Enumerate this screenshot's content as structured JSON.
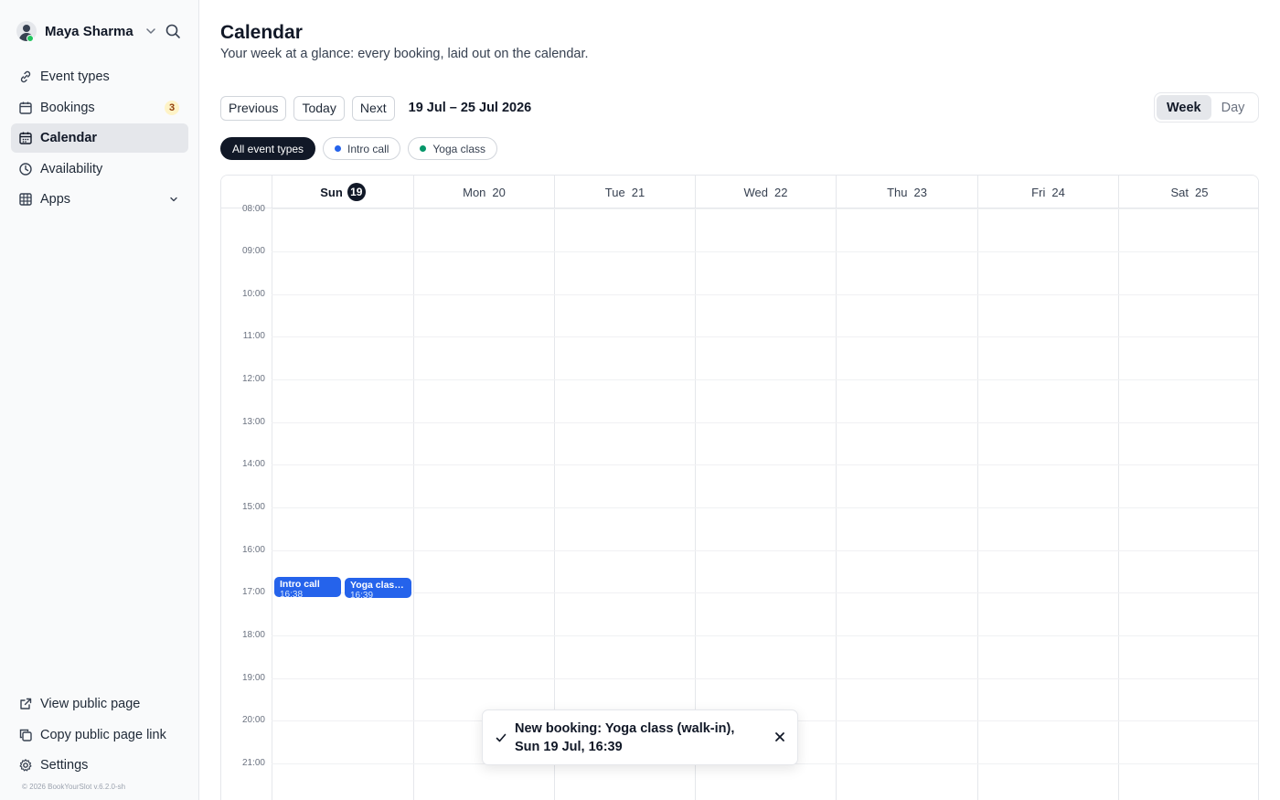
{
  "user": {
    "name": "Maya Sharma",
    "avatar_icon": "user-avatar-icon",
    "status": "online"
  },
  "sidebar": {
    "items": [
      {
        "label": "Event types",
        "icon": "link-icon"
      },
      {
        "label": "Bookings",
        "icon": "calendar-icon",
        "badge": "3"
      },
      {
        "label": "Calendar",
        "icon": "calendar-grid-icon",
        "active": true
      },
      {
        "label": "Availability",
        "icon": "clock-icon"
      },
      {
        "label": "Apps",
        "icon": "grid-icon",
        "expandable": true
      }
    ],
    "bottom_items": [
      {
        "label": "View public page",
        "icon": "external-link-icon"
      },
      {
        "label": "Copy public page link",
        "icon": "copy-icon"
      },
      {
        "label": "Settings",
        "icon": "gear-icon"
      }
    ],
    "copyright": "© 2026 BookYourSlot v.6.2.0-sh"
  },
  "page": {
    "title": "Calendar",
    "subtitle": "Your week at a glance: every booking, laid out on the calendar."
  },
  "toolbar": {
    "previous": "Previous",
    "today": "Today",
    "next": "Next",
    "range": "19 Jul – 25 Jul 2026",
    "views": [
      "Week",
      "Day"
    ],
    "active_view": "Week"
  },
  "filters": [
    {
      "label": "All event types",
      "active": true
    },
    {
      "label": "Intro call",
      "color": "#2563eb"
    },
    {
      "label": "Yoga class",
      "color": "#059669"
    }
  ],
  "calendar": {
    "days": [
      {
        "name": "Sun",
        "num": "19",
        "today": true
      },
      {
        "name": "Mon",
        "num": "20"
      },
      {
        "name": "Tue",
        "num": "21"
      },
      {
        "name": "Wed",
        "num": "22"
      },
      {
        "name": "Thu",
        "num": "23"
      },
      {
        "name": "Fri",
        "num": "24"
      },
      {
        "name": "Sat",
        "num": "25"
      }
    ],
    "hours": [
      "08:00",
      "09:00",
      "10:00",
      "11:00",
      "12:00",
      "13:00",
      "14:00",
      "15:00",
      "16:00",
      "17:00",
      "18:00",
      "19:00",
      "20:00",
      "21:00"
    ],
    "events": [
      {
        "title": "Intro call",
        "time": "16:38",
        "color": "#2563eb"
      },
      {
        "title": "Yoga class (walk-in)",
        "time": "16:39",
        "color": "#2563eb"
      }
    ]
  },
  "toast": {
    "message": "New booking: Yoga class (walk-in), Sun 19 Jul, 16:39",
    "icon": "check-icon"
  }
}
